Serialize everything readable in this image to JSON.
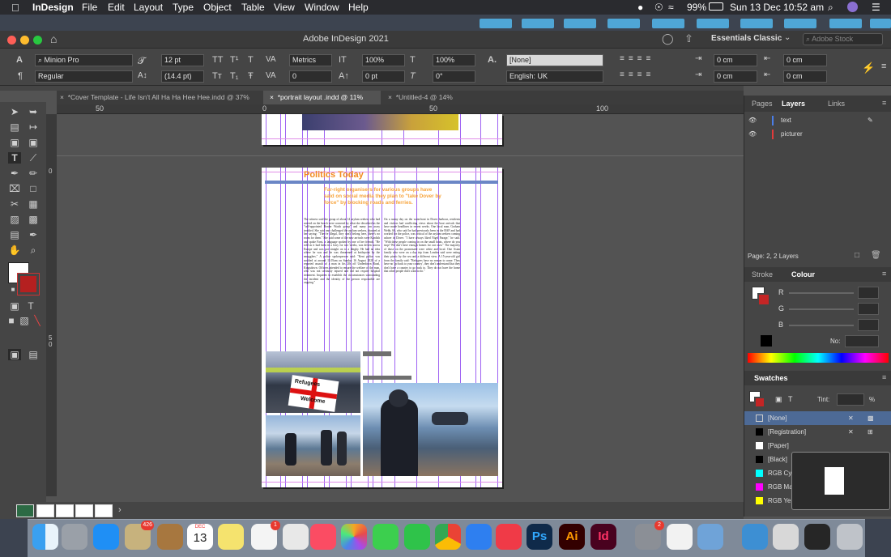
{
  "menubar": {
    "app": "InDesign",
    "items": [
      "File",
      "Edit",
      "Layout",
      "Type",
      "Object",
      "Table",
      "View",
      "Window",
      "Help"
    ],
    "battery": "99%",
    "datetime": "Sun 13 Dec  10:52 am"
  },
  "window": {
    "title": "Adobe InDesign 2021",
    "workspace": "Essentials Classic",
    "search_placeholder": "Adobe Stock"
  },
  "control": {
    "font": "Minion Pro",
    "style": "Regular",
    "size": "12 pt",
    "leading": "(14.4 pt)",
    "kerning": "Metrics",
    "tracking": "0",
    "hscale": "100%",
    "vscale": "100%",
    "baseline": "0 pt",
    "skew": "0°",
    "charstyle": "[None]",
    "language": "English: UK",
    "indent1": "0 cm",
    "indent2": "0 cm",
    "indent3": "0 cm",
    "indent4": "0 cm"
  },
  "tabs": [
    {
      "label": "*Cover Template - Life Isn't All Ha Ha Hee Hee.indd @ 37%"
    },
    {
      "label": "*portrait layout .indd @ 11%"
    },
    {
      "label": "*Untitled-4 @ 14%"
    }
  ],
  "ruler": {
    "t1": "50",
    "t2": "0",
    "t3": "50",
    "t4": "100",
    "v1": "0",
    "v2": "5",
    "v3": "0"
  },
  "doc": {
    "headline": "Politics Today",
    "deck": "Far-right organisers for various groups have said on social media they plan to \"take Dover by force\" by blocking roads and ferries.",
    "col1": "The witness said the group of about 14 asylum seekers who had arrived on the beach were cornered by what she described as the \"self-appointed Border Watch group\" and many ran away terrified. She said one challenged the asylum seekers, shouted at her saying: \"They're illegal, they don't belong here, there's no room for them.\" She said some of the new arrivals were Kurdish and spoke Farsi, a language spoken by one of her friends. \"He told us it had been in a lorry for two weeks, was driven across Europe and was put straight on to a dinghy. He had no idea where he was and he was threatened at knifepoint by the smugglers.\" A police spokesperson said: \"Kent police was notified at around 11.05am on Sunday 16 August 2020 of a reported assault of a man in his 20s off Underdown Road, Kingsdown. Officers attended to ensure the welfare of the man, who was not seriously injured and did not require hospital treatment. Inquiries to establish the circumstances surrounding the incident and the identity of the person responsible are ongoing.\"",
    "col2": "On a sunny day on the waterfront in Dover harbour, residents and visitors had conflicting views about the boat arrivals that have made headlines in recent weeks. One local man, Graham Webb, 66, who said he had previously been in the RAF and had worked for the police, was critical of the asylum seekers coming ashore in Dover. \"I have always liked Nigel Farage,\" he said. \"With these people coming in on the small boats, where do you stop? We don't have enough homes for our own.\" The majority of those on the promenade were white and local. One Asian family who were on a day trip from London said were eating their picnic by the sea and a different view. A 15-year-old girl from the family said: \"Refugees have no reason to come. They have no 'go back to your country', they don't understand that they don't have a country to go back to. They do not have the home that other people don't want to do.\"",
    "sign1": "Refugees",
    "sign2": "Welcome"
  },
  "layers_panel": {
    "tabs": [
      "Pages",
      "Layers",
      "Links"
    ],
    "layers": [
      "text",
      "picturer"
    ],
    "footer": "Page: 2, 2 Layers"
  },
  "colour_panel": {
    "tabs": [
      "Stroke",
      "Colour"
    ],
    "r": "R",
    "g": "G",
    "b": "B",
    "no_label": "No:"
  },
  "swatches_panel": {
    "title": "Swatches",
    "tint_label": "Tint:",
    "pct": "%",
    "items": [
      {
        "name": "[None]",
        "color": "#ffffff"
      },
      {
        "name": "[Registration]",
        "color": "#000000"
      },
      {
        "name": "[Paper]",
        "color": "#ffffff"
      },
      {
        "name": "[Black]",
        "color": "#000000"
      },
      {
        "name": "RGB Cy",
        "color": "#00ffff"
      },
      {
        "name": "RGB Ma",
        "color": "#ff00ff"
      },
      {
        "name": "RGB Ye",
        "color": "#ffff00"
      }
    ]
  },
  "dock": {
    "calendar_month": "DEC",
    "calendar_day": "13",
    "mail_badge": "426",
    "reminders_badge": "1",
    "prefs_badge": "2",
    "apps": [
      "Finder",
      "Launchpad",
      "App Store",
      "Preview",
      "Contacts",
      "Calendar",
      "Notes",
      "Reminders",
      "Photos",
      "Music",
      "Photos App",
      "Messages",
      "FaceTime",
      "Chrome",
      "Safari",
      "News",
      "Photoshop",
      "Illustrator",
      "InDesign",
      "System Preferences",
      "TextEdit",
      "Preview",
      "Folder",
      "Screenshot",
      "Screenshot",
      "Trash"
    ],
    "ps": "Ps",
    "ai": "Ai",
    "id": "Id"
  }
}
